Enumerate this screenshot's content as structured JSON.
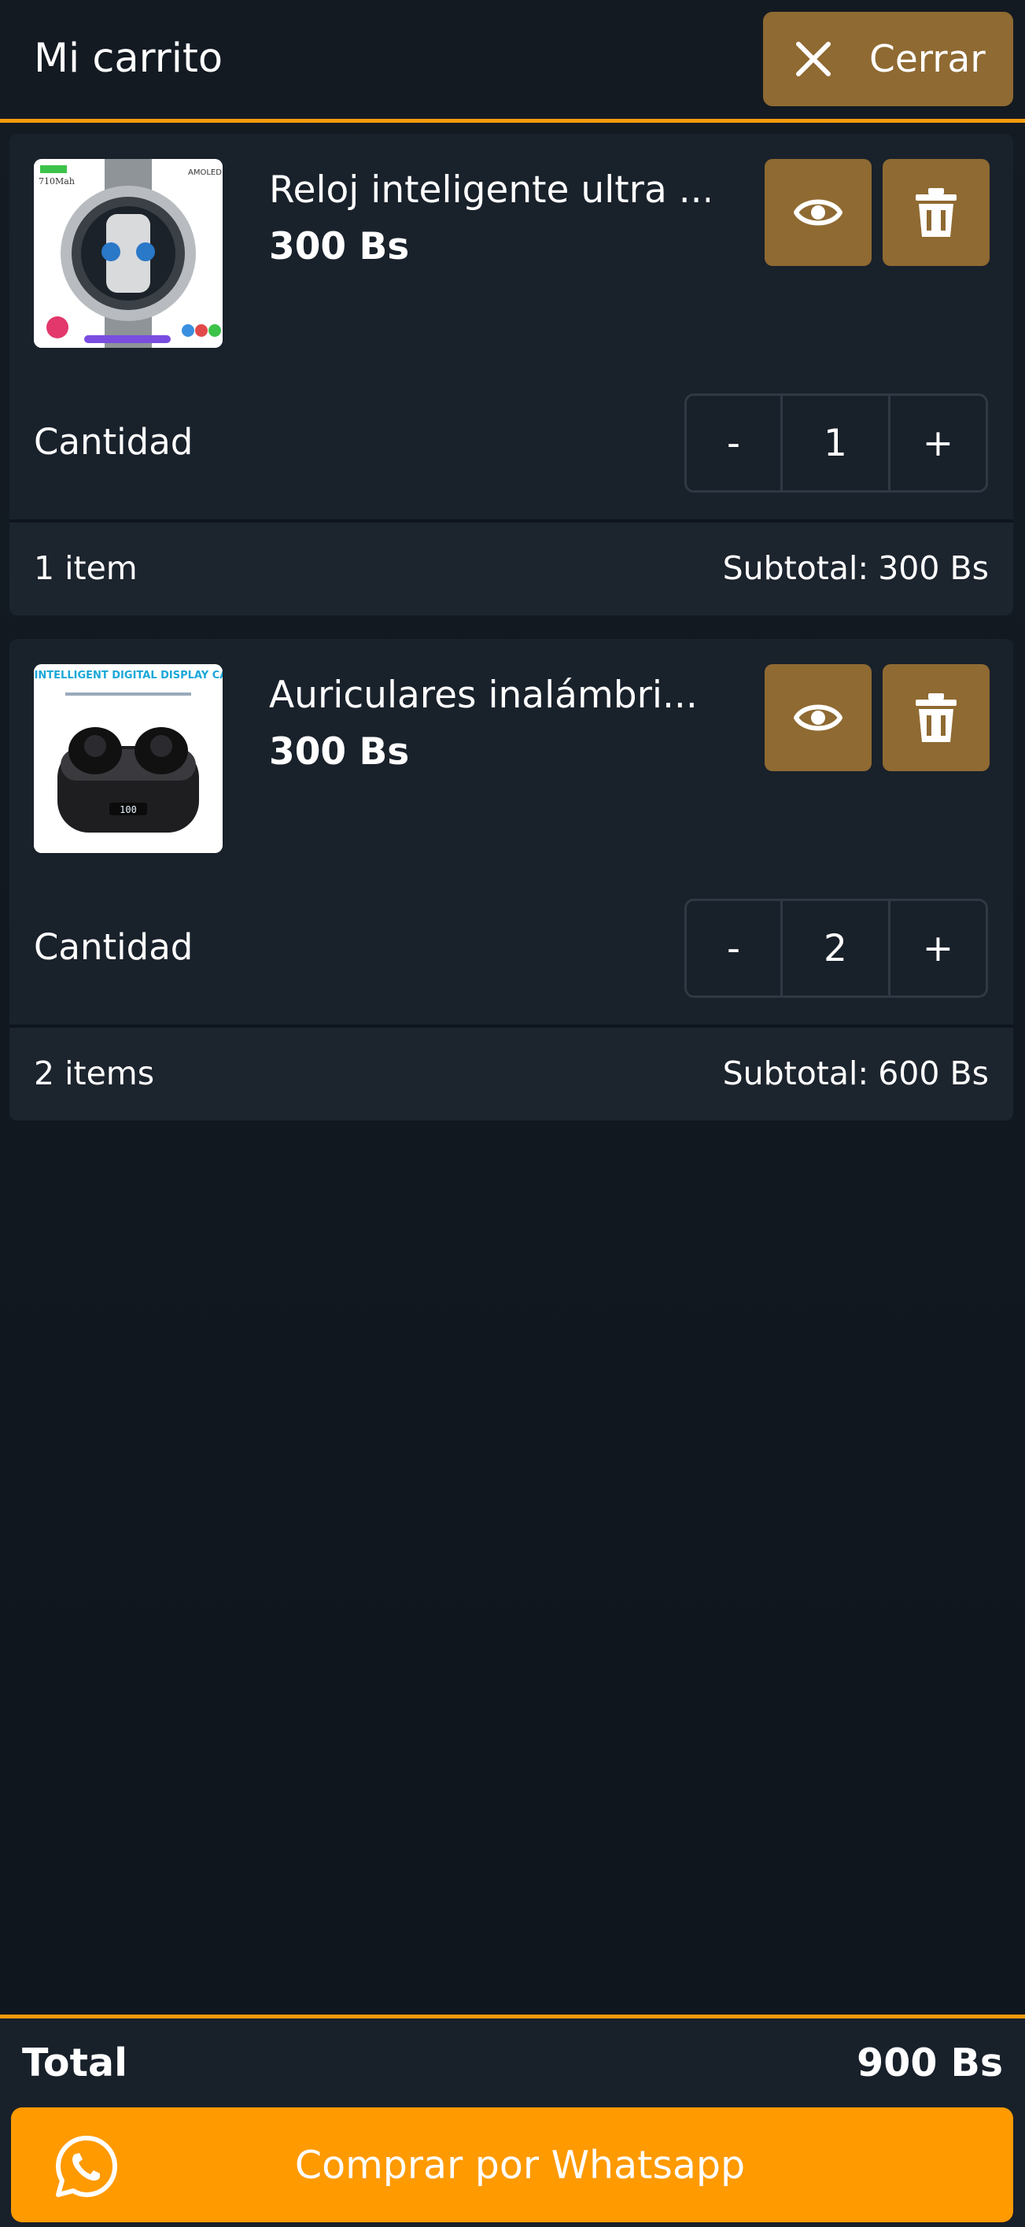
{
  "header": {
    "title": "Mi carrito",
    "close_label": "Cerrar"
  },
  "cart": {
    "items": [
      {
        "name": "Reloj inteligente ultra ...",
        "price": "300 Bs",
        "quantity_label": "Cantidad",
        "quantity": "1",
        "minus": "-",
        "plus": "+",
        "items_count": "1 item",
        "subtotal_label": "Subtotal:",
        "subtotal_value": "300 Bs",
        "image_icon": "smartwatch-image"
      },
      {
        "name": "Auriculares inalámbri...",
        "price": "300 Bs",
        "quantity_label": "Cantidad",
        "quantity": "2",
        "minus": "-",
        "plus": "+",
        "items_count": "2 items",
        "subtotal_label": "Subtotal:",
        "subtotal_value": "600 Bs",
        "image_icon": "earbuds-image",
        "image_caption": "LED INTELLIGENT DIGITAL DISPLAY CABIN"
      }
    ]
  },
  "footer": {
    "total_label": "Total",
    "total_value": "900 Bs",
    "buy_label": "Comprar por Whatsapp"
  },
  "colors": {
    "accent": "#f59a0b",
    "button_brown": "#8f6a32",
    "whatsapp_button": "#ff9a00",
    "background": "#111820"
  }
}
